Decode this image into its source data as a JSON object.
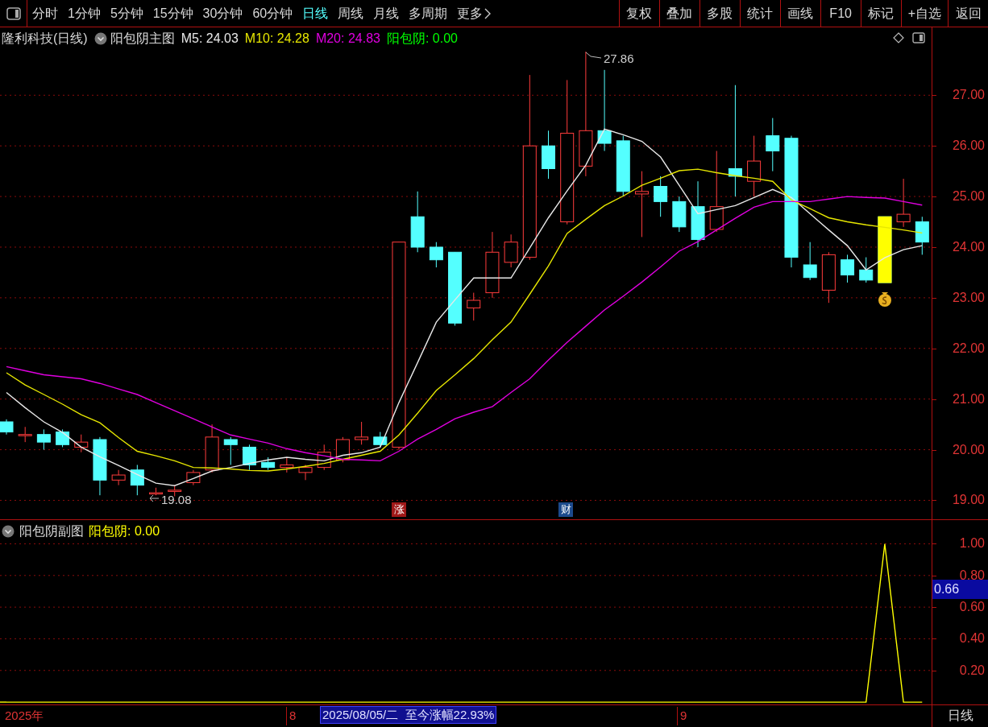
{
  "toolbar": {
    "periods": [
      {
        "label": "分时",
        "selected": false
      },
      {
        "label": "1分钟",
        "selected": false
      },
      {
        "label": "5分钟",
        "selected": false
      },
      {
        "label": "15分钟",
        "selected": false
      },
      {
        "label": "30分钟",
        "selected": false
      },
      {
        "label": "60分钟",
        "selected": false
      },
      {
        "label": "日线",
        "selected": true
      },
      {
        "label": "周线",
        "selected": false
      },
      {
        "label": "月线",
        "selected": false
      },
      {
        "label": "多周期",
        "selected": false
      }
    ],
    "more": "更多",
    "buttons": [
      "复权",
      "叠加",
      "多股",
      "统计",
      "画线",
      "F10",
      "标记",
      "+自选",
      "返回"
    ]
  },
  "main_chart": {
    "title": "隆利科技(日线)",
    "indicator": "阳包阴主图",
    "legend_values": [
      ": 24.03",
      ": 24.28",
      ": 24.83"
    ],
    "signal": {
      "label": "阳包阴: 0.00",
      "color": "#00ff00"
    },
    "high_label": "27.86",
    "low_label": "19.08",
    "event_markers": [
      {
        "text": "涨",
        "color": "#a01818"
      },
      {
        "text": "财",
        "color": "#1c4a8c"
      }
    ],
    "chart_data": {
      "type": "candlestick",
      "grid": true,
      "ylim": [
        18.61,
        28.34
      ],
      "ohlc": [
        [
          20.55,
          20.6,
          20.3,
          20.35
        ],
        [
          20.3,
          20.45,
          20.15,
          20.3
        ],
        [
          20.3,
          20.4,
          20.0,
          20.15
        ],
        [
          20.35,
          20.4,
          20.05,
          20.1
        ],
        [
          20.05,
          20.3,
          19.95,
          20.15
        ],
        [
          20.2,
          20.25,
          19.1,
          19.4
        ],
        [
          19.4,
          19.6,
          19.3,
          19.5
        ],
        [
          19.6,
          19.7,
          19.1,
          19.3
        ],
        [
          19.15,
          19.25,
          19.1,
          19.15
        ],
        [
          19.2,
          19.3,
          19.08,
          19.2
        ],
        [
          19.35,
          19.6,
          19.3,
          19.55
        ],
        [
          19.6,
          20.5,
          19.55,
          20.25
        ],
        [
          20.2,
          20.25,
          19.7,
          20.1
        ],
        [
          20.05,
          20.1,
          19.6,
          19.7
        ],
        [
          19.75,
          19.85,
          19.6,
          19.65
        ],
        [
          19.65,
          19.85,
          19.55,
          19.7
        ],
        [
          19.55,
          19.7,
          19.4,
          19.65
        ],
        [
          19.65,
          20.1,
          19.6,
          19.95
        ],
        [
          19.8,
          20.25,
          19.75,
          20.2
        ],
        [
          20.2,
          20.55,
          20.1,
          20.25
        ],
        [
          20.25,
          20.35,
          20.05,
          20.1
        ],
        [
          20.05,
          24.1,
          20.0,
          24.1
        ],
        [
          24.6,
          25.1,
          23.9,
          24.0
        ],
        [
          24.0,
          24.1,
          23.6,
          23.75
        ],
        [
          23.9,
          23.9,
          22.45,
          22.5
        ],
        [
          22.8,
          23.1,
          22.55,
          22.95
        ],
        [
          23.1,
          24.3,
          23.0,
          23.9
        ],
        [
          23.7,
          24.25,
          23.6,
          24.1
        ],
        [
          23.8,
          27.4,
          23.75,
          26.0
        ],
        [
          26.0,
          26.3,
          25.35,
          25.55
        ],
        [
          24.5,
          27.3,
          24.45,
          26.25
        ],
        [
          25.6,
          27.86,
          25.4,
          26.3
        ],
        [
          26.3,
          27.5,
          25.9,
          26.05
        ],
        [
          26.1,
          26.2,
          25.0,
          25.1
        ],
        [
          25.05,
          25.5,
          24.2,
          25.1
        ],
        [
          25.2,
          25.4,
          24.6,
          24.9
        ],
        [
          24.9,
          25.0,
          24.3,
          24.4
        ],
        [
          24.8,
          25.3,
          24.0,
          24.15
        ],
        [
          24.35,
          25.9,
          24.3,
          24.8
        ],
        [
          25.55,
          27.2,
          25.0,
          25.4
        ],
        [
          25.3,
          26.2,
          25.0,
          25.7
        ],
        [
          26.2,
          26.55,
          25.5,
          25.9
        ],
        [
          26.15,
          26.2,
          23.6,
          23.8
        ],
        [
          23.65,
          24.1,
          23.35,
          23.4
        ],
        [
          23.15,
          23.9,
          22.9,
          23.85
        ],
        [
          23.75,
          23.85,
          23.3,
          23.45
        ],
        [
          23.55,
          23.8,
          23.3,
          23.35
        ],
        [
          24.6,
          24.6,
          23.3,
          23.3
        ],
        [
          24.5,
          25.35,
          24.4,
          24.65
        ],
        [
          24.5,
          24.6,
          23.85,
          24.1
        ]
      ],
      "series": [
        {
          "name": "M5",
          "type": "line",
          "color": "#e8e8e8",
          "values": [
            21.13,
            20.83,
            20.55,
            20.34,
            20.05,
            19.86,
            19.69,
            19.51,
            19.34,
            19.29,
            19.43,
            19.58,
            19.65,
            19.73,
            19.8,
            19.85,
            19.81,
            19.78,
            19.89,
            19.94,
            20.05,
            20.93,
            21.72,
            22.52,
            22.96,
            23.39,
            23.39,
            23.39,
            23.98,
            24.58,
            25.11,
            25.62,
            26.33,
            26.22,
            26.09,
            25.78,
            25.22,
            24.66,
            24.74,
            24.82,
            24.98,
            25.14,
            24.98,
            24.66,
            24.34,
            24.03,
            23.55,
            23.79,
            23.95,
            24.03
          ]
        },
        {
          "name": "M10",
          "type": "line",
          "color": "#e6e600",
          "values": [
            21.52,
            21.28,
            21.09,
            20.9,
            20.69,
            20.53,
            20.24,
            19.97,
            19.88,
            19.78,
            19.65,
            19.64,
            19.62,
            19.59,
            19.58,
            19.62,
            19.67,
            19.73,
            19.81,
            19.89,
            19.97,
            20.29,
            20.72,
            21.17,
            21.48,
            21.8,
            22.17,
            22.52,
            23.07,
            23.63,
            24.27,
            24.55,
            24.82,
            25.01,
            25.22,
            25.36,
            25.51,
            25.54,
            25.47,
            25.41,
            25.36,
            25.3,
            24.93,
            24.76,
            24.58,
            24.5,
            24.44,
            24.39,
            24.34,
            24.28
          ]
        },
        {
          "name": "M20",
          "type": "line",
          "color": "#e000e0",
          "values": [
            21.64,
            21.56,
            21.48,
            21.44,
            21.4,
            21.31,
            21.2,
            21.09,
            20.93,
            20.77,
            20.61,
            20.45,
            20.29,
            20.21,
            20.13,
            20.02,
            19.94,
            19.88,
            19.81,
            19.8,
            19.78,
            19.97,
            20.21,
            20.4,
            20.61,
            20.74,
            20.85,
            21.13,
            21.4,
            21.77,
            22.12,
            22.44,
            22.76,
            23.03,
            23.31,
            23.61,
            23.92,
            24.11,
            24.34,
            24.57,
            24.79,
            24.9,
            24.9,
            24.9,
            24.95,
            25.0,
            24.98,
            24.97,
            24.9,
            24.83
          ]
        }
      ],
      "yticks": [
        {
          "value": 27,
          "label": "27.00"
        },
        {
          "value": 26,
          "label": "26.00"
        },
        {
          "value": 25,
          "label": "25.00"
        },
        {
          "value": 24,
          "label": "24.00"
        },
        {
          "value": 23,
          "label": "23.00"
        },
        {
          "value": 22,
          "label": "22.00"
        },
        {
          "value": 21,
          "label": "21.00"
        },
        {
          "value": 20,
          "label": "20.00"
        },
        {
          "value": 19,
          "label": "19.00"
        }
      ]
    }
  },
  "sub_chart": {
    "title": "阳包阴副图",
    "legend_value": ": 0.00",
    "cursor_value": "0.66",
    "chart_data": {
      "type": "line",
      "grid": true,
      "ylim": [
        -0.02,
        1.15
      ],
      "series": [
        {
          "name": "阳包阴",
          "color": "#ffff00",
          "values": [
            0,
            0,
            0,
            0,
            0,
            0,
            0,
            0,
            0,
            0,
            0,
            0,
            0,
            0,
            0,
            0,
            0,
            0,
            0,
            0,
            0,
            0,
            0,
            0,
            0,
            0,
            0,
            0,
            0,
            0,
            0,
            0,
            0,
            0,
            0,
            0,
            0,
            0,
            0,
            0,
            0,
            0,
            0,
            0,
            0,
            0,
            0,
            1,
            0,
            0
          ]
        }
      ],
      "yticks": [
        {
          "value": 1,
          "label": "1.00"
        },
        {
          "value": 0.8,
          "label": "0.80"
        },
        {
          "value": 0.6,
          "label": "0.60"
        },
        {
          "value": 0.4,
          "label": "0.40"
        },
        {
          "value": 0.2,
          "label": "0.20"
        }
      ]
    }
  },
  "timeline": {
    "year": "2025年",
    "months": [
      "8",
      "9"
    ],
    "cursor_info": "2025/08/05/二  至今涨幅22.93%"
  },
  "period_label": "日线"
}
